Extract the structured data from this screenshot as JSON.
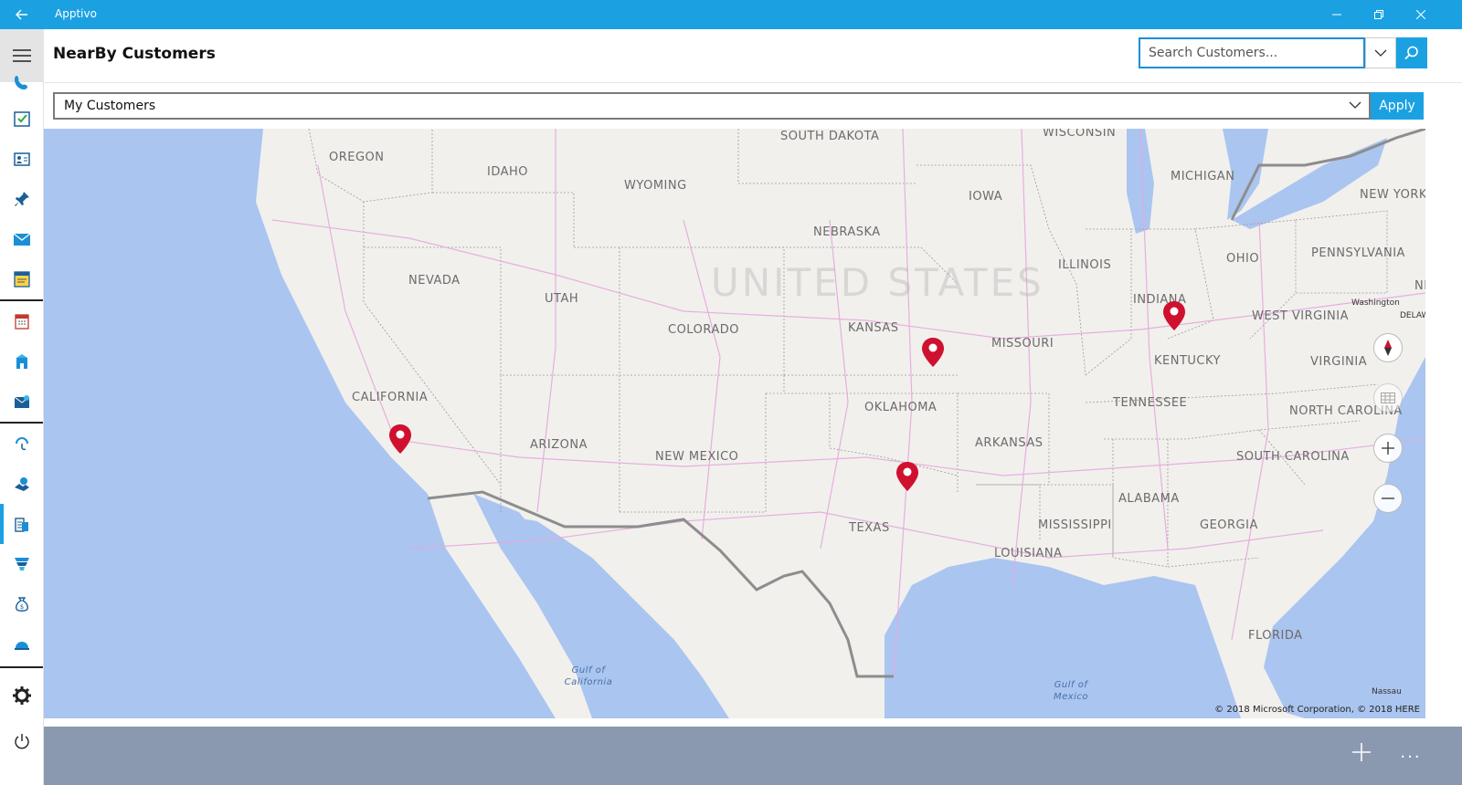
{
  "app": {
    "title": "Apptivo"
  },
  "header": {
    "title": "NearBy Customers"
  },
  "search": {
    "placeholder": "Search Customers..."
  },
  "filter": {
    "selected": "My Customers",
    "apply_label": "Apply"
  },
  "sidebar": {
    "items": [
      {
        "icon": "phone-icon"
      },
      {
        "icon": "tasks-icon"
      },
      {
        "icon": "contacts-icon"
      },
      {
        "icon": "pin-icon"
      },
      {
        "icon": "mail-icon"
      },
      {
        "icon": "notes-icon"
      },
      {
        "icon": "calendar-icon"
      },
      {
        "icon": "building-icon"
      },
      {
        "icon": "email-app-icon"
      },
      {
        "icon": "support-icon"
      },
      {
        "icon": "handshake-icon"
      },
      {
        "icon": "customers-icon",
        "active": true
      },
      {
        "icon": "funnel-icon"
      },
      {
        "icon": "money-bag-icon"
      },
      {
        "icon": "helmet-icon"
      }
    ],
    "settings_icon": "gear-icon",
    "power_icon": "power-icon"
  },
  "map": {
    "country_label": "UNITED STATES",
    "states": [
      "OREGON",
      "IDAHO",
      "WYOMING",
      "SOUTH DAKOTA",
      "WISCONSIN",
      "MICHIGAN",
      "NEW YORK",
      "IOWA",
      "NEBRASKA",
      "NEVADA",
      "UTAH",
      "COLORADO",
      "KANSAS",
      "ILLINOIS",
      "INDIANA",
      "OHIO",
      "PENNSYLVANIA",
      "MISSOURI",
      "WEST VIRGINIA",
      "KENTUCKY",
      "VIRGINIA",
      "CALIFORNIA",
      "OKLAHOMA",
      "TENNESSEE",
      "NORTH CAROLINA",
      "ARIZONA",
      "NEW MEXICO",
      "ARKANSAS",
      "SOUTH CAROLINA",
      "ALABAMA",
      "TEXAS",
      "MISSISSIPPI",
      "GEORGIA",
      "LOUISIANA",
      "FLORIDA"
    ],
    "cities": [
      "Washington",
      "Nassau"
    ],
    "water": [
      "Gulf of California",
      "Gulf of Mexico"
    ],
    "partial": [
      "NEW",
      "DELAWA"
    ],
    "copyright": "© 2018 Microsoft Corporation, © 2018 HERE",
    "pin_color": "#d0102f",
    "pins": [
      "customer-pin-california",
      "customer-pin-kansas",
      "customer-pin-texas",
      "customer-pin-indiana"
    ]
  },
  "appbar": {
    "more_label": "..."
  },
  "colors": {
    "accent": "#1ba1e2",
    "appbar": "#8a99b0",
    "water": "#aac5ef",
    "land": "#f1f0ed"
  }
}
